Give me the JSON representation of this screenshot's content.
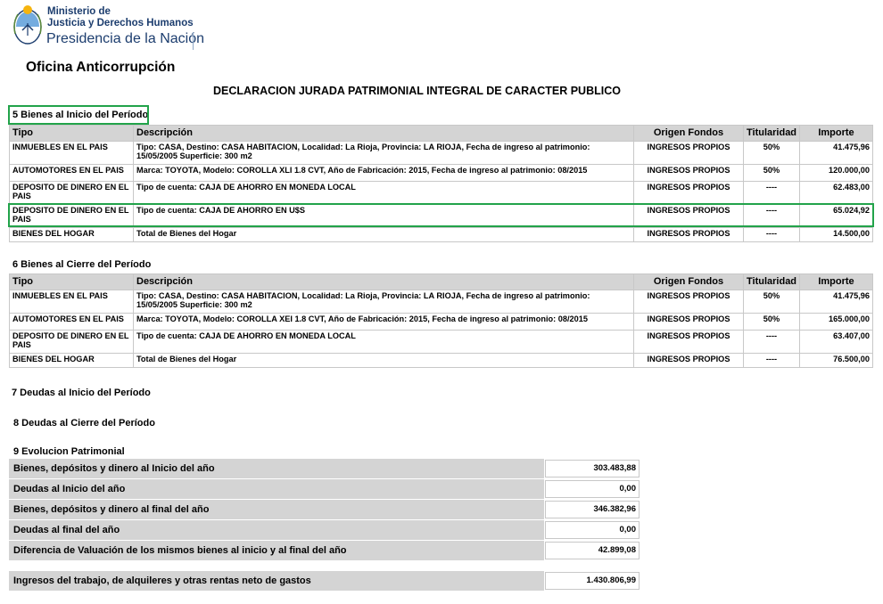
{
  "header": {
    "ministry_line1": "Ministerio de",
    "ministry_line2": "Justicia y Derechos Humanos",
    "presidency": "Presidencia de la Nación",
    "office": "Oficina Anticorrupción",
    "title": "DECLARACION JURADA PATRIMONIAL INTEGRAL DE CARACTER PUBLICO"
  },
  "columns": [
    "Tipo",
    "Descripción",
    "Origen Fondos",
    "Titularidad",
    "Importe"
  ],
  "section5": {
    "title": "5 Bienes al Inicio del Período",
    "rows": [
      {
        "tipo": "INMUEBLES EN EL PAIS",
        "descripcion": "Tipo: CASA, Destino: CASA HABITACION, Localidad: La Rioja, Provincia: LA RIOJA, Fecha de ingreso al patrimonio: 15/05/2005 Superficie: 300 m2",
        "origen": "INGRESOS PROPIOS",
        "titularidad": "50%",
        "importe": "41.475,96"
      },
      {
        "tipo": "AUTOMOTORES EN EL PAIS",
        "descripcion": "Marca: TOYOTA, Modelo: COROLLA XLI 1.8 CVT, Año de Fabricación: 2015, Fecha de ingreso al patrimonio: 08/2015",
        "origen": "INGRESOS PROPIOS",
        "titularidad": "50%",
        "importe": "120.000,00"
      },
      {
        "tipo": "DEPOSITO DE DINERO EN EL PAIS",
        "descripcion": "Tipo de cuenta: CAJA DE AHORRO EN MONEDA LOCAL",
        "origen": "INGRESOS PROPIOS",
        "titularidad": "----",
        "importe": "62.483,00"
      },
      {
        "tipo": "DEPOSITO DE DINERO EN EL PAIS",
        "descripcion": "Tipo de cuenta: CAJA DE AHORRO EN U$S",
        "origen": "INGRESOS PROPIOS",
        "titularidad": "----",
        "importe": "65.024,92"
      },
      {
        "tipo": "BIENES DEL HOGAR",
        "descripcion": "Total de Bienes del Hogar",
        "origen": "INGRESOS PROPIOS",
        "titularidad": "----",
        "importe": "14.500,00"
      }
    ]
  },
  "section6": {
    "title": "6 Bienes al Cierre del Período",
    "rows": [
      {
        "tipo": "INMUEBLES EN EL PAIS",
        "descripcion": "Tipo: CASA, Destino: CASA HABITACION, Localidad: La Rioja, Provincia: LA RIOJA, Fecha de ingreso al patrimonio: 15/05/2005 Superficie: 300 m2",
        "origen": "INGRESOS PROPIOS",
        "titularidad": "50%",
        "importe": "41.475,96"
      },
      {
        "tipo": "AUTOMOTORES EN EL PAIS",
        "descripcion": "Marca: TOYOTA, Modelo: COROLLA XEI 1.8 CVT, Año de Fabricación: 2015, Fecha de ingreso al patrimonio: 08/2015",
        "origen": "INGRESOS PROPIOS",
        "titularidad": "50%",
        "importe": "165.000,00"
      },
      {
        "tipo": "DEPOSITO DE DINERO EN EL PAIS",
        "descripcion": "Tipo de cuenta: CAJA DE AHORRO EN MONEDA LOCAL",
        "origen": "INGRESOS PROPIOS",
        "titularidad": "----",
        "importe": "63.407,00"
      },
      {
        "tipo": "BIENES DEL HOGAR",
        "descripcion": "Total de Bienes del Hogar",
        "origen": "INGRESOS PROPIOS",
        "titularidad": "----",
        "importe": "76.500,00"
      }
    ]
  },
  "section7": {
    "title": "7 Deudas al Inicio del Período"
  },
  "section8": {
    "title": "8 Deudas al Cierre del Período"
  },
  "section9": {
    "title": "9 Evolucion Patrimonial",
    "rows": [
      {
        "label": "Bienes, depósitos y dinero al Inicio del año",
        "value": "303.483,88"
      },
      {
        "label": "Deudas al Inicio del año",
        "value": "0,00"
      },
      {
        "label": "Bienes, depósitos y dinero al final del año",
        "value": "346.382,96"
      },
      {
        "label": "Deudas al final del año",
        "value": "0,00"
      },
      {
        "label": "Diferencia de Valuación de los mismos bienes al inicio y al final del año",
        "value": "42.899,08"
      }
    ],
    "income": {
      "label": "Ingresos del trabajo, de alquileres y otras rentas neto de gastos",
      "value": "1.430.806,99"
    }
  },
  "colors": {
    "highlight": "#22a34a",
    "header_bg": "#d4d4d4",
    "brand_blue": "#1c3d6e"
  }
}
